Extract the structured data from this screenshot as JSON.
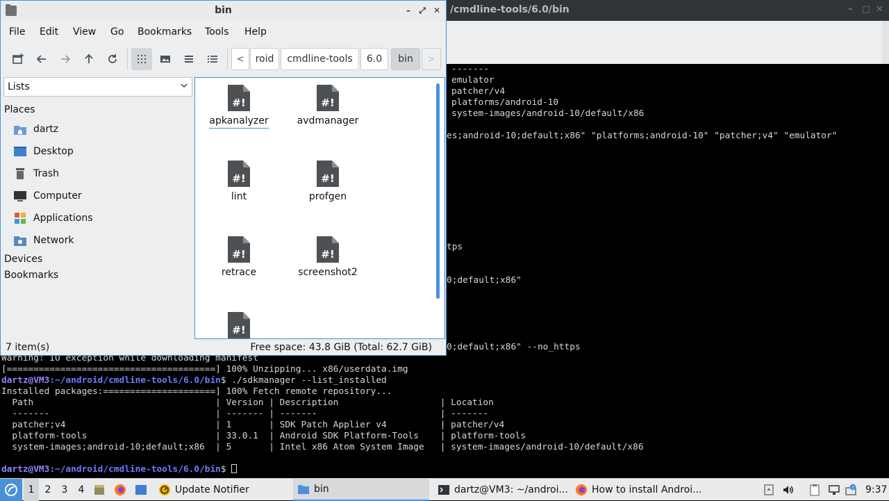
{
  "terminal": {
    "title": "/cmdline-tools/6.0/bin",
    "controls": [
      "–",
      "□",
      "✕"
    ],
    "lines_upper": [
      "-------",
      "emulator",
      "patcher/v4",
      "platforms/android-10",
      "system-images/android-10/default/x86",
      "es;android-10;default;x86\" \"platforms;android-10\" \"patcher;v4\" \"emulator\"",
      "tps",
      "0;default;x86\"",
      "0;default;x86\" --no_https"
    ],
    "lines_lower": [
      "Warning: IO exception while downloading manifest",
      "[=======================================] 100% Unzipping... x86/userdata.img"
    ],
    "prompt_user": "dartz@VM3",
    "prompt_path": ":~/android/cmdline-tools/6.0/bin",
    "command1": "$ ./sdkmanager --list_installed",
    "output": [
      "Installed packages:=====================] 100% Fetch remote repository...",
      "  Path                                  | Version | Description                   | Location",
      "  -------                               | ------- | -------                       | -------",
      "  patcher;v4                            | 1       | SDK Patch Applier v4          | patcher/v4",
      "  platform-tools                        | 33.0.1  | Android SDK Platform-Tools    | platform-tools",
      "  system-images;android-10;default;x86  | 5       | Intel x86 Atom System Image   | system-images/android-10/default/x86"
    ],
    "prompt_end": "$ "
  },
  "file_manager": {
    "title": "bin",
    "window_buttons": {
      "minimize": "–",
      "maximize": "⤢",
      "close": "✕"
    },
    "menu": [
      "File",
      "Edit",
      "View",
      "Go",
      "Bookmarks",
      "Tools",
      "Help"
    ],
    "breadcrumb": [
      "roid",
      "cmdline-tools",
      "6.0",
      "bin"
    ],
    "breadcrumb_prev": "<",
    "breadcrumb_next": ">",
    "side_pane_mode": "Lists",
    "places_heading": "Places",
    "places": [
      "dartz",
      "Desktop",
      "Trash",
      "Computer",
      "Applications",
      "Network"
    ],
    "devices_heading": "Devices",
    "bookmarks_heading": "Bookmarks",
    "files": [
      "apkanalyzer",
      "avdmanager",
      "lint",
      "profgen",
      "retrace",
      "screenshot2",
      ""
    ],
    "file_icon_glyph": "#!",
    "status_count": "7 item(s)",
    "status_space": "Free space: 43.8 GiB (Total: 62.7 GiB)"
  },
  "taskbar": {
    "workspaces": [
      "1",
      "2",
      "3",
      "4"
    ],
    "tasks": [
      "Update Notifier",
      "bin",
      "dartz@VM3: ~/androi...",
      "How to install Androi..."
    ],
    "clock": "9:37"
  },
  "colors": {
    "accent": "#4a90d9",
    "prompt_user": "#8f86ff",
    "prompt_path": "#6a7cff"
  }
}
